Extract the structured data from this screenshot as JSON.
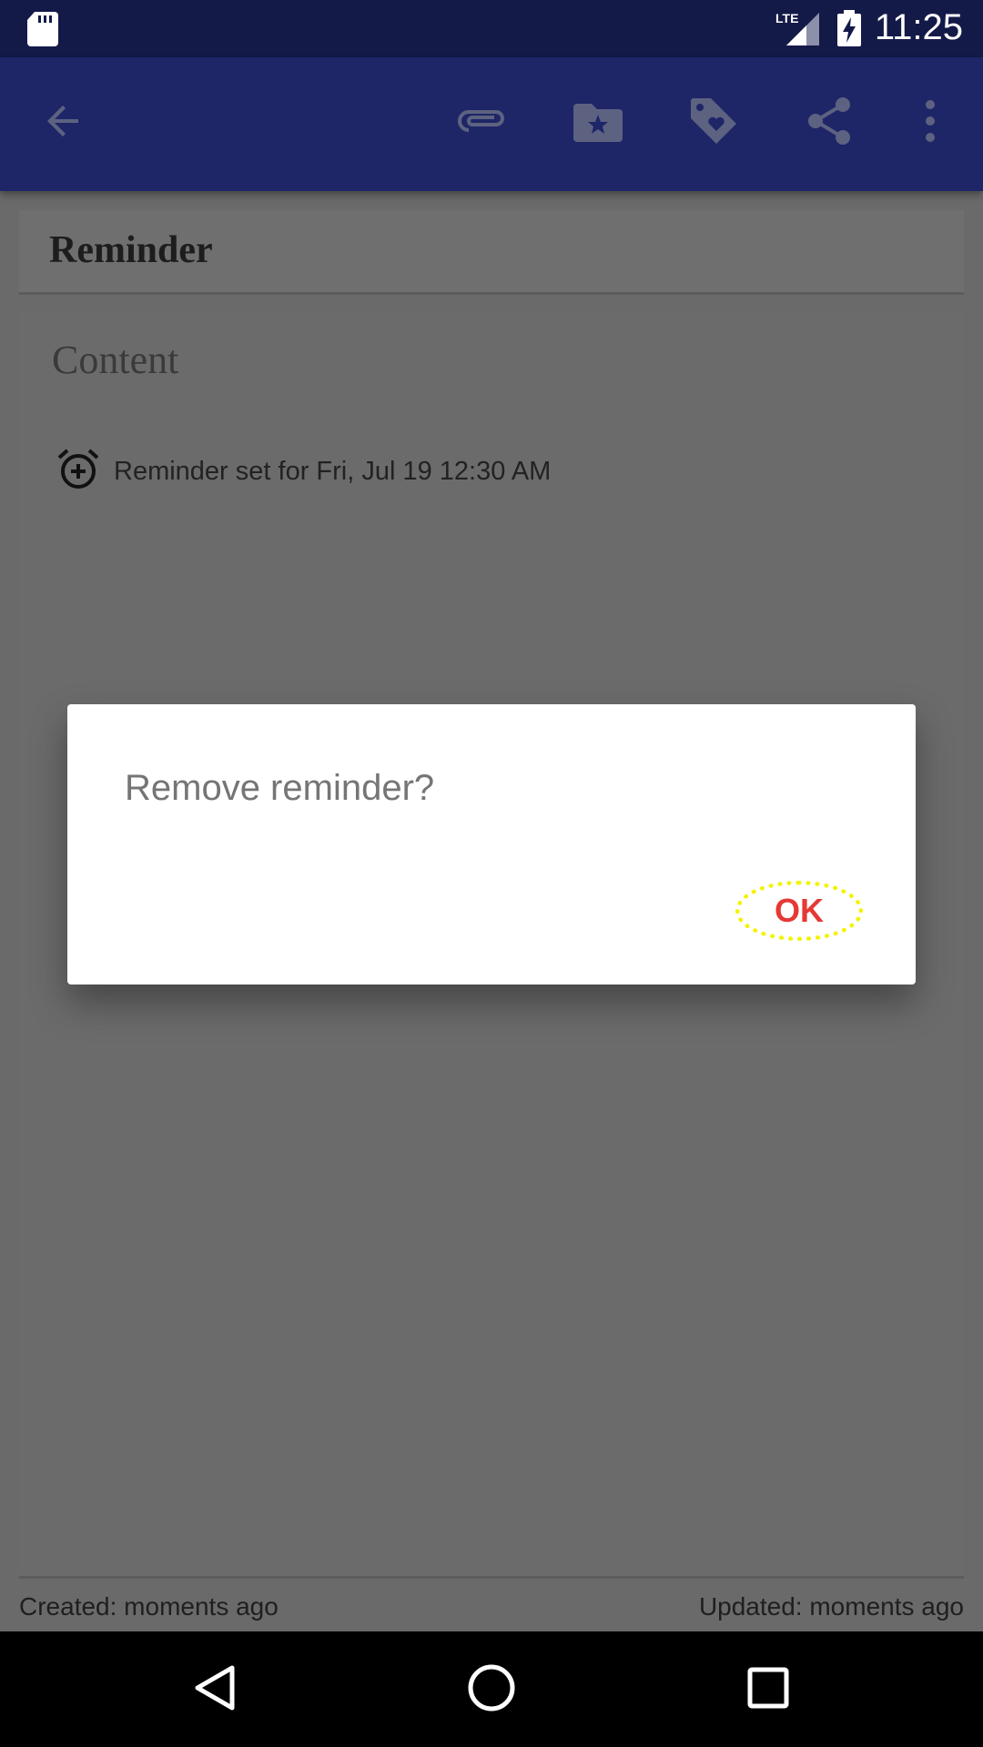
{
  "status_bar": {
    "time": "11:25",
    "network_label": "LTE",
    "icons": [
      "sd-card-icon",
      "signal-icon",
      "battery-charging-icon"
    ]
  },
  "app_bar": {
    "actions": [
      "back-arrow-icon",
      "attachment-icon",
      "folder-star-icon",
      "tag-heart-icon",
      "share-icon",
      "more-vert-icon"
    ]
  },
  "note": {
    "title": "Reminder",
    "content_placeholder": "Content",
    "reminder_text": "Reminder set for Fri, Jul 19 12:30 AM",
    "created": "Created: moments ago",
    "updated": "Updated: moments ago"
  },
  "dialog": {
    "message": "Remove reminder?",
    "ok_label": "OK"
  },
  "nav_bar": {
    "icons": [
      "back-triangle-icon",
      "home-circle-icon",
      "recents-square-icon"
    ]
  },
  "colors": {
    "status_bar": "#141a48",
    "app_bar": "#1e2667",
    "scrim_content": "#6a6a6a",
    "ok_text": "#e53935",
    "ok_highlight": "#f3f300"
  }
}
